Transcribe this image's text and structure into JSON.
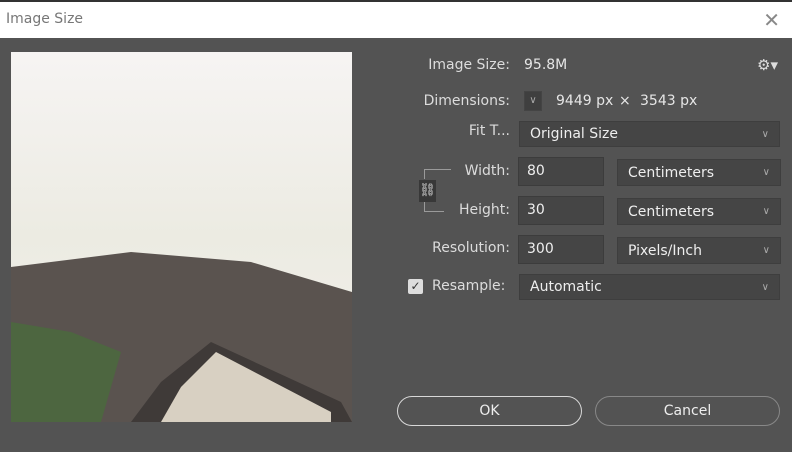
{
  "window": {
    "title": "Image Size"
  },
  "info": {
    "image_size_label": "Image Size:",
    "image_size_value": "95.8M",
    "dimensions_label": "Dimensions:",
    "dimensions_width": "9449 px",
    "dimensions_x": "×",
    "dimensions_height": "3543 px"
  },
  "fit_to": {
    "label": "Fit T...",
    "value": "Original Size"
  },
  "width": {
    "label": "Width:",
    "value": "80",
    "unit": "Centimeters"
  },
  "height": {
    "label": "Height:",
    "value": "30",
    "unit": "Centimeters"
  },
  "resolution": {
    "label": "Resolution:",
    "value": "300",
    "unit": "Pixels/Inch"
  },
  "resample": {
    "label": "Resample:",
    "checked": true,
    "value": "Automatic"
  },
  "buttons": {
    "ok": "OK",
    "cancel": "Cancel"
  }
}
